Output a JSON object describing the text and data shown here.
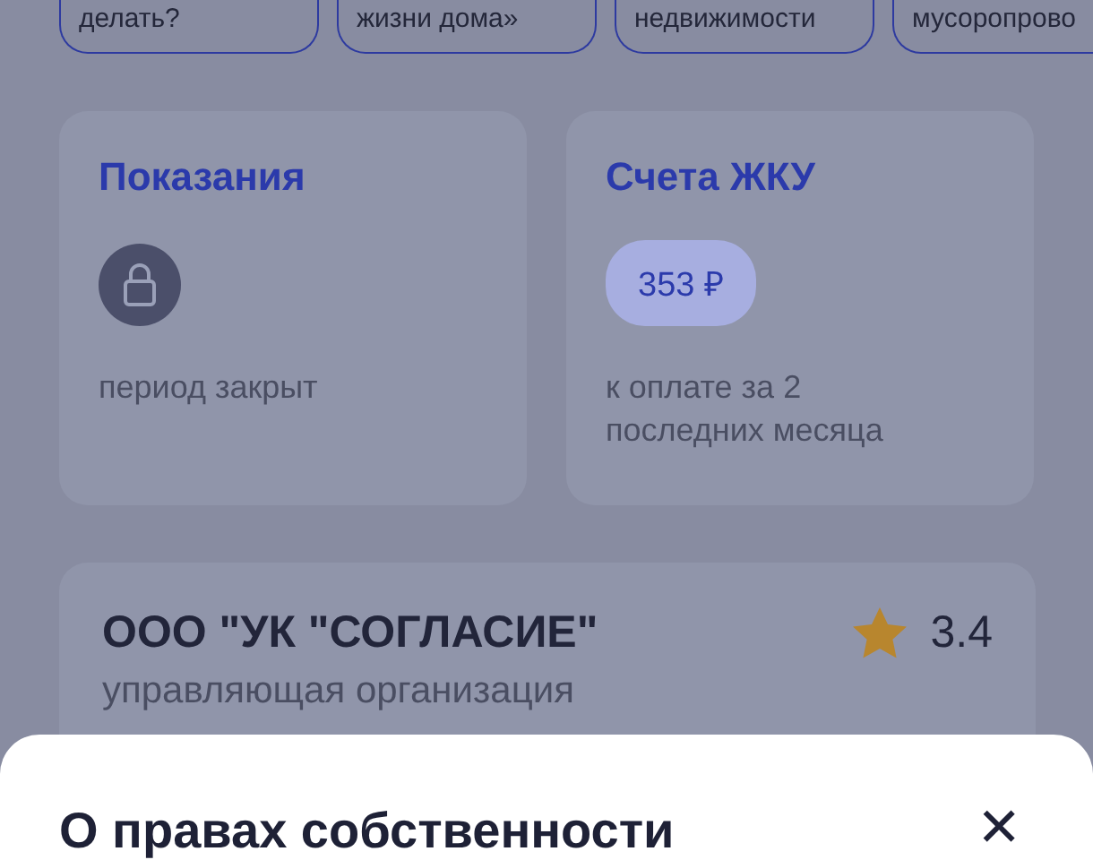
{
  "chips": [
    {
      "label": "делать?"
    },
    {
      "label": "жизни дома»"
    },
    {
      "label": "недвижимости"
    },
    {
      "label": "мусоропрово"
    }
  ],
  "cards": [
    {
      "kind": "locked",
      "title": "Показания",
      "caption": "период закрыт"
    },
    {
      "kind": "amount",
      "title": "Счета ЖКУ",
      "amount": "353 ₽",
      "caption": "к оплате за 2 последних месяца"
    }
  ],
  "company": {
    "name": "ООО \"УК \"СОГЛАСИЕ\"",
    "role": "управляющая организация",
    "rating": "3.4"
  },
  "sheet": {
    "title": "О правах собственности",
    "close": "✕"
  }
}
